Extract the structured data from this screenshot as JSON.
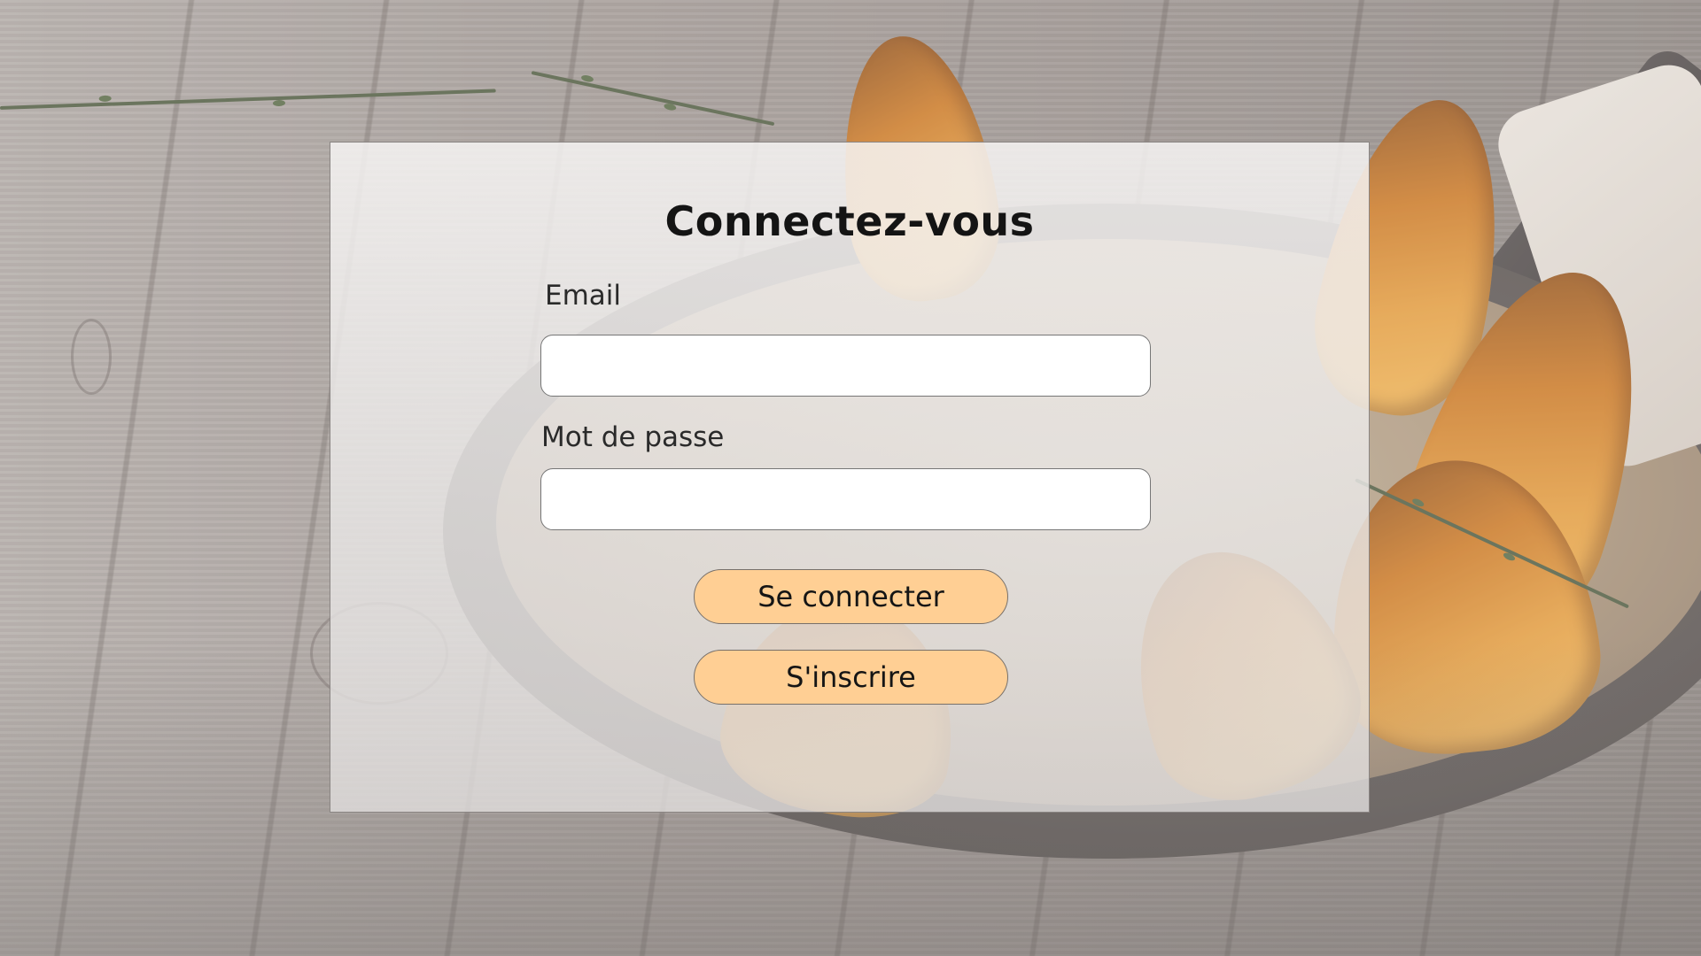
{
  "login": {
    "title": "Connectez-vous",
    "email_label": "Email",
    "email_value": "",
    "password_label": "Mot de passe",
    "password_value": "",
    "login_button": "Se connecter",
    "signup_button": "S'inscrire"
  },
  "colors": {
    "button_fill": "#ffcf94",
    "input_fill": "#ffffff",
    "title_text": "#141414"
  },
  "background": {
    "image": "roasted-squash-skillet-on-wood-table"
  }
}
